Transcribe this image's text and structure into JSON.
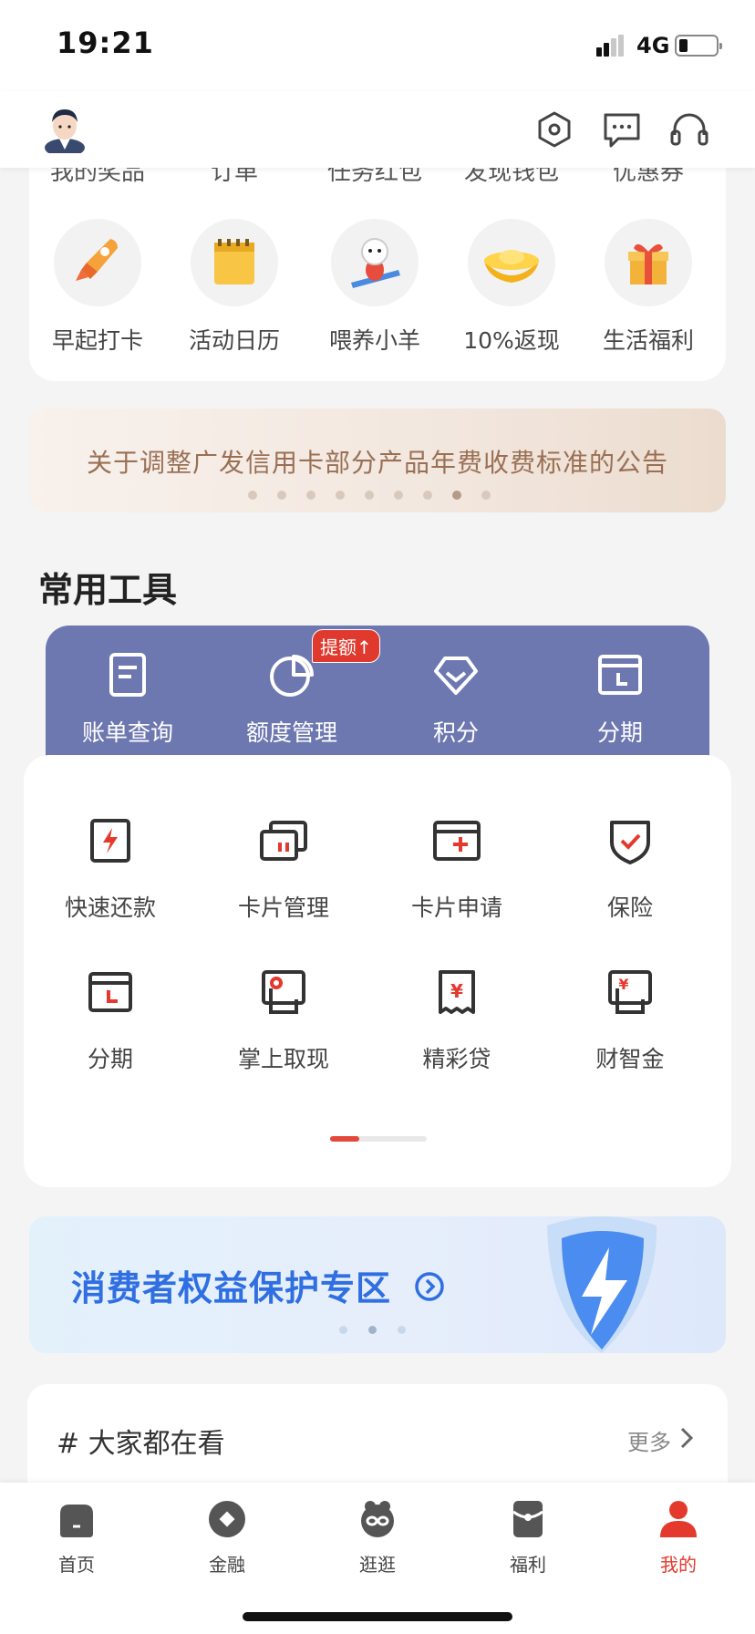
{
  "status_bar": {
    "time": "19:21",
    "network": "4G"
  },
  "header": {
    "icons": [
      "settings-icon",
      "message-icon",
      "headset-icon"
    ]
  },
  "top_card": {
    "clipped_labels": [
      "我的奖品",
      "订单",
      "任务红包",
      "发现钱包",
      "优惠券"
    ],
    "items": [
      {
        "label": "早起打卡",
        "icon": "rocket-icon"
      },
      {
        "label": "活动日历",
        "icon": "calendar-icon"
      },
      {
        "label": "喂养小羊",
        "icon": "sheep-icon"
      },
      {
        "label": "10%返现",
        "icon": "gold-ingot-icon"
      },
      {
        "label": "生活福利",
        "icon": "gift-icon"
      }
    ]
  },
  "notice": {
    "text": "关于调整广发信用卡部分产品年费收费标准的公告",
    "dot_count": 9,
    "active_dot": 7
  },
  "tools_section": {
    "title": "常用工具",
    "badge": "提额↑",
    "primary": [
      {
        "label": "账单查询",
        "icon": "bill-icon"
      },
      {
        "label": "额度管理",
        "icon": "pie-chart-icon"
      },
      {
        "label": "积分",
        "icon": "diamond-icon"
      },
      {
        "label": "分期",
        "icon": "installment-icon"
      }
    ],
    "grid": [
      {
        "label": "快速还款",
        "icon": "lightning-card-icon"
      },
      {
        "label": "卡片管理",
        "icon": "cards-icon"
      },
      {
        "label": "卡片申请",
        "icon": "add-card-icon"
      },
      {
        "label": "保险",
        "icon": "shield-check-icon"
      },
      {
        "label": "分期",
        "icon": "installment-icon"
      },
      {
        "label": "掌上取现",
        "icon": "cash-card-icon"
      },
      {
        "label": "精彩贷",
        "icon": "yuan-doc-icon"
      },
      {
        "label": "财智金",
        "icon": "yuan-card-icon"
      }
    ]
  },
  "consumer_banner": {
    "text": "消费者权益保护专区",
    "dot_count": 3,
    "active_dot": 1
  },
  "watch": {
    "title": "# 大家都在看",
    "more": "更多"
  },
  "tabbar": {
    "items": [
      {
        "label": "首页",
        "icon": "home-icon"
      },
      {
        "label": "金融",
        "icon": "finance-icon"
      },
      {
        "label": "逛逛",
        "icon": "browse-icon"
      },
      {
        "label": "福利",
        "icon": "welfare-icon"
      },
      {
        "label": "我的",
        "icon": "profile-icon"
      }
    ],
    "active": 4
  },
  "colors": {
    "accent": "#e4392d",
    "tools_bg": "#6e78b0",
    "link_blue": "#2f6fe2"
  }
}
